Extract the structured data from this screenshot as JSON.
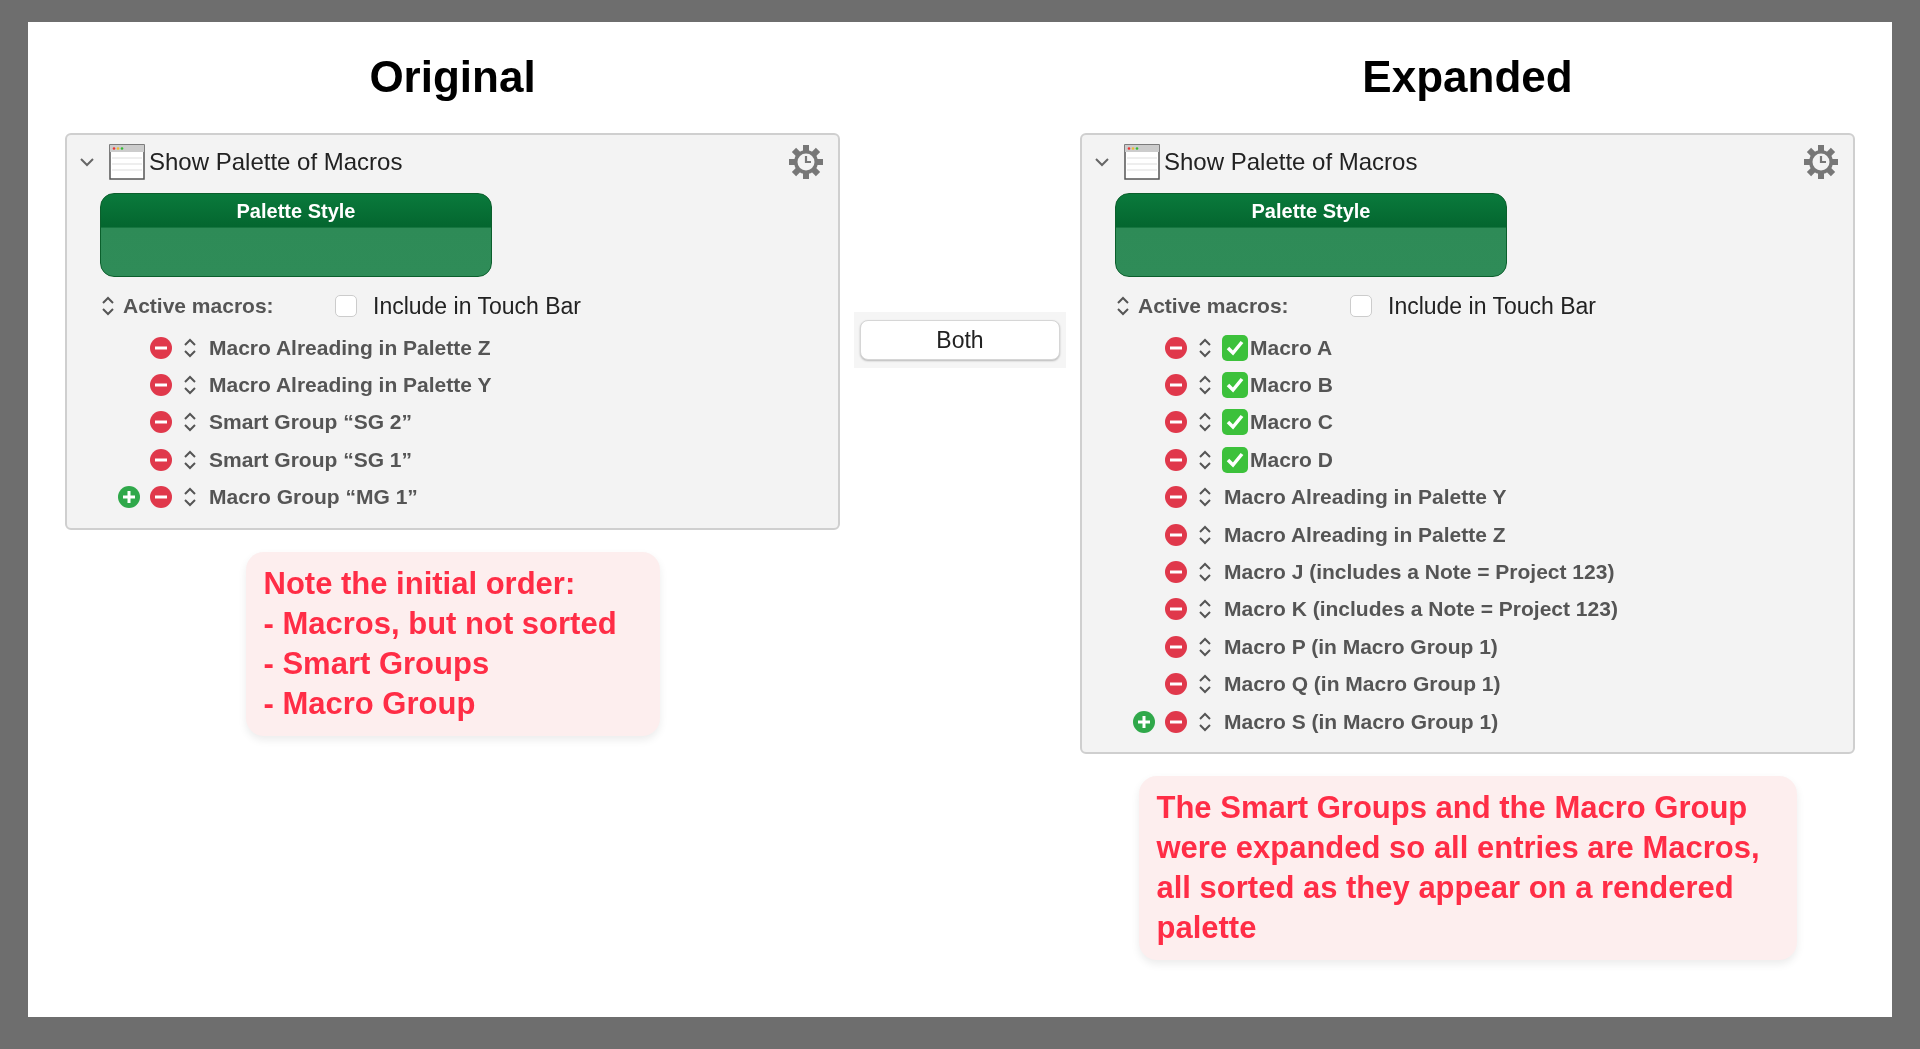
{
  "columns": [
    {
      "heading": "Original",
      "panel": {
        "title": "Show Palette of Macros",
        "expanded": true,
        "style_button": "Palette Style",
        "active_label": "Active macros:",
        "touch_bar": {
          "label": "Include in Touch Bar",
          "checked": false
        },
        "rows": [
          {
            "label": "Macro Alreading in Palette Z",
            "checkmark": false,
            "add_button": false
          },
          {
            "label": "Macro Alreading in Palette Y",
            "checkmark": false,
            "add_button": false
          },
          {
            "label": "Smart Group “SG 2”",
            "checkmark": false,
            "add_button": false
          },
          {
            "label": "Smart Group “SG 1”",
            "checkmark": false,
            "add_button": false
          },
          {
            "label": "Macro Group “MG 1”",
            "checkmark": false,
            "add_button": true
          }
        ]
      },
      "note": [
        "Note the initial order:",
        "- Macros, but not sorted",
        "- Smart Groups",
        "- Macro Group"
      ]
    },
    {
      "heading": "Expanded",
      "panel": {
        "title": "Show Palette of Macros",
        "expanded": true,
        "style_button": "Palette Style",
        "active_label": "Active macros:",
        "touch_bar": {
          "label": "Include in Touch Bar",
          "checked": false
        },
        "rows": [
          {
            "label": "Macro A",
            "checkmark": true,
            "add_button": false
          },
          {
            "label": "Macro B",
            "checkmark": true,
            "add_button": false
          },
          {
            "label": "Macro C",
            "checkmark": true,
            "add_button": false
          },
          {
            "label": "Macro D",
            "checkmark": true,
            "add_button": false
          },
          {
            "label": "Macro Alreading in Palette Y",
            "checkmark": false,
            "add_button": false
          },
          {
            "label": "Macro Alreading in Palette Z",
            "checkmark": false,
            "add_button": false
          },
          {
            "label": "Macro J (includes a Note = Project 123)",
            "checkmark": false,
            "add_button": false
          },
          {
            "label": "Macro K (includes a Note = Project 123)",
            "checkmark": false,
            "add_button": false
          },
          {
            "label": "Macro P (in Macro Group 1)",
            "checkmark": false,
            "add_button": false
          },
          {
            "label": "Macro Q (in Macro Group 1)",
            "checkmark": false,
            "add_button": false
          },
          {
            "label": "Macro S (in Macro Group 1)",
            "checkmark": false,
            "add_button": true
          }
        ]
      },
      "note": [
        "The Smart Groups and the Macro Group were expanded so all entries are Macros, all sorted as they appear on a rendered palette"
      ]
    }
  ],
  "middle_button": "Both"
}
